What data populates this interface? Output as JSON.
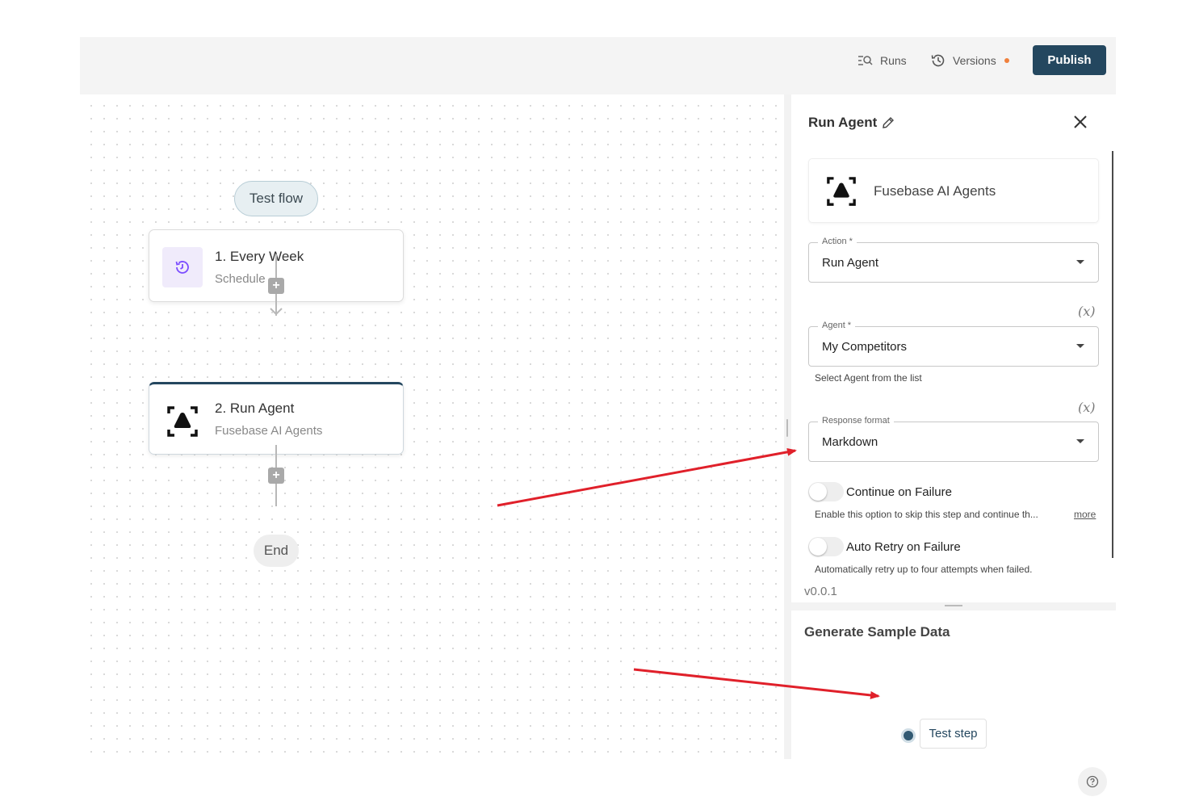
{
  "toolbar": {
    "runs_label": "Runs",
    "versions_label": "Versions",
    "publish_label": "Publish"
  },
  "canvas": {
    "test_flow_label": "Test flow",
    "steps": [
      {
        "title": "1. Every Week",
        "subtitle": "Schedule",
        "icon": "clock-schedule-icon"
      },
      {
        "title": "2. Run Agent",
        "subtitle": "Fusebase AI Agents",
        "icon": "fusebase-agent-icon"
      }
    ],
    "end_label": "End"
  },
  "panel": {
    "title": "Run Agent",
    "piece_name": "Fusebase AI Agents",
    "action": {
      "label": "Action *",
      "value": "Run Agent"
    },
    "agent": {
      "label": "Agent *",
      "value": "My Competitors",
      "hint": "Select Agent from the list"
    },
    "response_format": {
      "label": "Response format",
      "value": "Markdown"
    },
    "fx_label": "(x)",
    "continue_on_failure": {
      "label": "Continue on Failure",
      "description": "Enable this option to skip this step and continue th...",
      "more": "more",
      "enabled": false
    },
    "auto_retry": {
      "label": "Auto Retry on Failure",
      "description": "Automatically retry up to four attempts when failed.",
      "enabled": false
    },
    "version": "v0.0.1"
  },
  "sample_data": {
    "title": "Generate Sample Data",
    "test_step_label": "Test step"
  },
  "colors": {
    "publish_bg": "#24475f",
    "annotation_arrow": "#e0202a",
    "versions_dot": "#f0803c"
  }
}
